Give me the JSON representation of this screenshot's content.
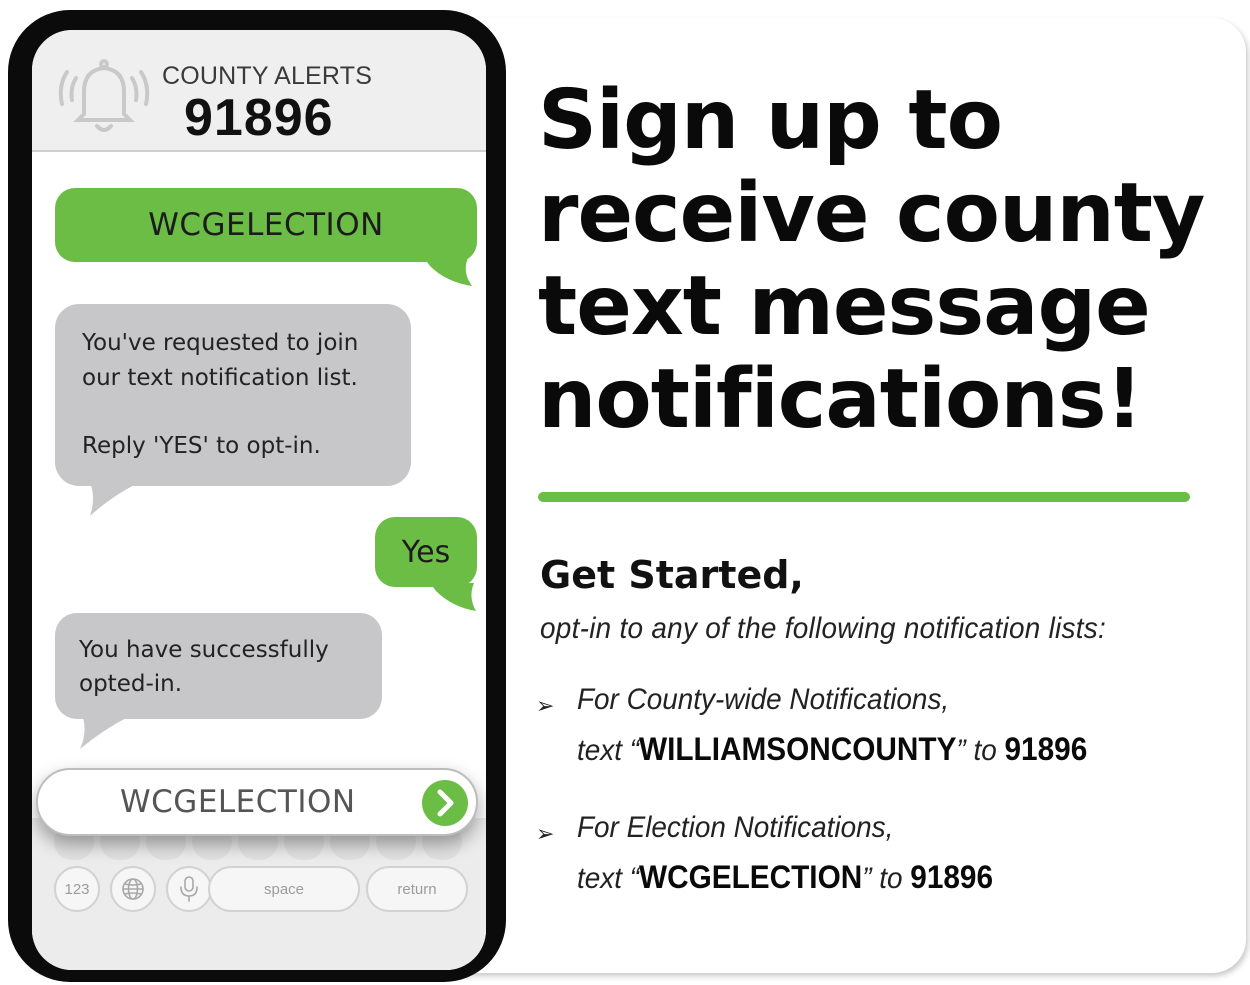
{
  "phone": {
    "header_label": "COUNTY ALERTS",
    "header_number": "91896",
    "messages": [
      {
        "from": "user",
        "text": "WCGELECTION"
      },
      {
        "from": "system",
        "lines": [
          "You've requested to join",
          "our text notification list.",
          "Reply 'YES' to opt-in."
        ]
      },
      {
        "from": "user",
        "text": "Yes"
      },
      {
        "from": "system",
        "lines": [
          "You have successfully",
          "opted-in."
        ]
      }
    ],
    "input_value": "WCGELECTION",
    "keyboard": {
      "num_key": "123",
      "space_key": "space",
      "return_key": "return"
    }
  },
  "headline": {
    "lines": [
      "Sign up to",
      "receive county",
      "text message",
      "notifications!"
    ]
  },
  "get_started": {
    "title": "Get Started,",
    "intro": "opt-in to any of the following notification lists:",
    "items": [
      {
        "label": "For County-wide Notifications,",
        "text_prefix": "text “",
        "keyword": "WILLIAMSONCOUNTY",
        "text_mid": "” to ",
        "number": "91896"
      },
      {
        "label": "For Election Notifications,",
        "text_prefix": "text “",
        "keyword": "WCGELECTION",
        "text_mid": "” to ",
        "number": "91896"
      }
    ]
  },
  "colors": {
    "accent_green": "#6cbd45",
    "bubble_gray": "#c7c7c9",
    "phone_frame": "#0b0b0b"
  }
}
